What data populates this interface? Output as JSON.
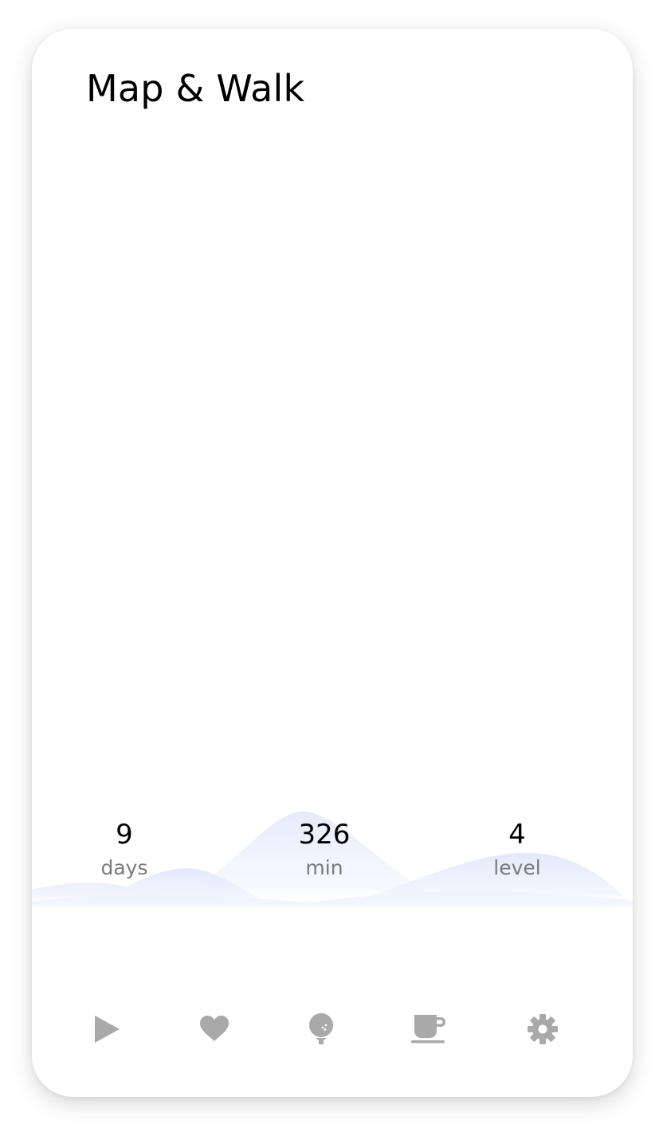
{
  "app": {
    "title": "Map & Walk"
  },
  "stats": [
    {
      "value": "9",
      "label": "days"
    },
    {
      "value": "326",
      "label": "min"
    },
    {
      "value": "4",
      "label": "level"
    }
  ],
  "tab_bar": {
    "items": [
      {
        "icon": "play-icon"
      },
      {
        "icon": "heart-icon"
      },
      {
        "icon": "golf-ball-icon"
      },
      {
        "icon": "coffee-cup-icon"
      },
      {
        "icon": "gear-icon"
      }
    ]
  },
  "colors": {
    "icon": "#a9a9a9",
    "wave": "#dfe6fb",
    "label": "#7a7a7a",
    "value": "#000000"
  }
}
